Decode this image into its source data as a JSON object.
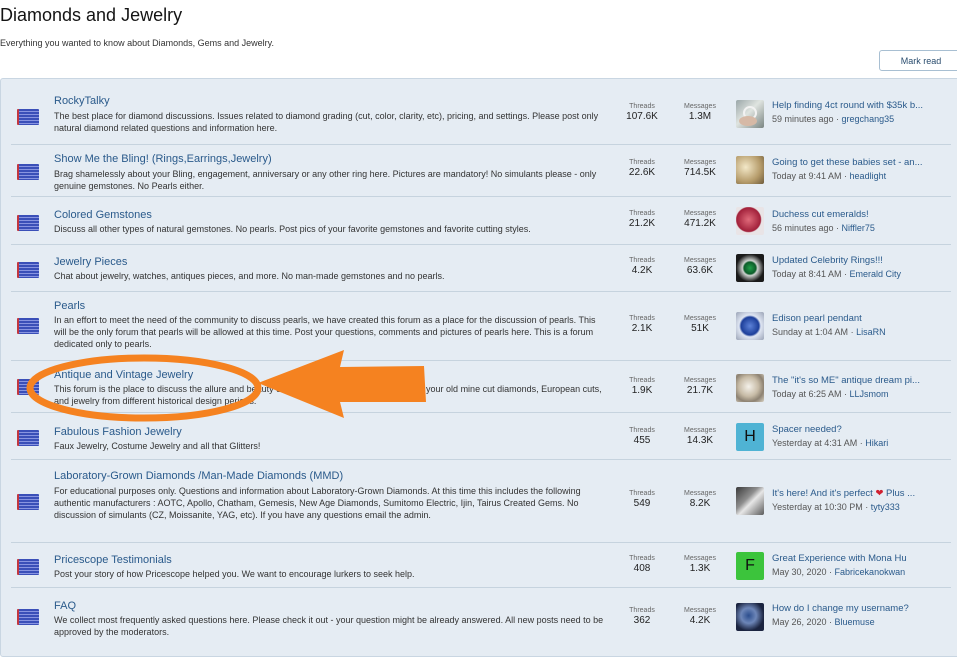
{
  "page": {
    "title": "Diamonds and Jewelry",
    "description": "Everything you wanted to know about Diamonds, Gems and Jewelry.",
    "mark_read_label": "Mark read"
  },
  "labels": {
    "threads": "Threads",
    "messages": "Messages"
  },
  "forums": [
    {
      "title": "RockyTalky",
      "description": "The best place for diamond discussions. Issues related to diamond grading (cut, color, clarity, etc), pricing, and settings. Please post only natural diamond related questions and information here.",
      "threads": "107.6K",
      "messages": "1.3M",
      "latest_title": "Help finding 4ct round with $35k b...",
      "latest_time": "59 minutes ago",
      "latest_user": "gregchang35",
      "avatar": "ring-hand-photo"
    },
    {
      "title": "Show Me the Bling! (Rings,Earrings,Jewelry)",
      "description": "Brag shamelessly about your Bling, engagement, anniversary or any other ring here. Pictures are mandatory! No simulants please - only genuine gemstones. No Pearls either.",
      "threads": "22.6K",
      "messages": "714.5K",
      "latest_title": "Going to get these babies set - an...",
      "latest_time": "Today at 9:41 AM",
      "latest_user": "headlight",
      "avatar": "earrings-photo"
    },
    {
      "title": "Colored Gemstones",
      "description": "Discuss all other types of natural gemstones. No pearls. Post pics of your favorite gemstones and favorite cutting styles.",
      "threads": "21.2K",
      "messages": "471.2K",
      "latest_title": "Duchess cut emeralds!",
      "latest_time": "56 minutes ago",
      "latest_user": "Niffler75",
      "avatar": "ruby-photo"
    },
    {
      "title": "Jewelry Pieces",
      "description": "Chat about jewelry, watches, antiques pieces, and more. No man-made gemstones and no pearls.",
      "threads": "4.2K",
      "messages": "63.6K",
      "latest_title": "Updated Celebrity Rings!!!",
      "latest_time": "Today at 8:41 AM",
      "latest_user": "Emerald City",
      "avatar": "emerald-ring-photo"
    },
    {
      "title": "Pearls",
      "description": "In an effort to meet the need of the community to discuss pearls, we have created this forum as a place for the discussion of pearls.  This will be the only forum that pearls will be allowed at this time.  Post your questions, comments and pictures of pearls here.  This is a forum dedicated only to pearls.",
      "threads": "2.1K",
      "messages": "51K",
      "latest_title": "Edison pearl pendant",
      "latest_time": "Sunday at 1:04 AM",
      "latest_user": "LisaRN",
      "avatar": "sapphire-photo"
    },
    {
      "title": "Antique and Vintage Jewelry",
      "description": "This forum is the place to discuss the allure and beauty of antique and vintage jewelry. Share your old mine cut diamonds, European cuts, and jewelry from different historical design periods.",
      "threads": "1.9K",
      "messages": "21.7K",
      "latest_title": "The \"it's so ME\" antique dream pi...",
      "latest_time": "Today at 6:25 AM",
      "latest_user": "LLJsmom",
      "avatar": "vintage-ring-photo"
    },
    {
      "title": "Fabulous Fashion Jewelry",
      "description": "Faux Jewelry, Costume Jewelry and all that Glitters!",
      "threads": "455",
      "messages": "14.3K",
      "latest_title": "Spacer needed?",
      "latest_time": "Yesterday at 4:31 AM",
      "latest_user": "Hikari",
      "avatar_letter": "H",
      "avatar_color": "#4fb3d4"
    },
    {
      "title": "Laboratory-Grown Diamonds /Man-Made Diamonds (MMD)",
      "description": "For educational purposes only. Questions and information about Laboratory-Grown Diamonds. At this time this includes the following authentic manufacturers : AOTC, Apollo, Chatham, Gemesis, New Age Diamonds, Sumitomo Electric, Ijin, Tairus Created Gems. No discussion of simulants (CZ, Moissanite, YAG, etc). If you have any questions email the admin.",
      "threads": "549",
      "messages": "8.2K",
      "latest_title": "It's here! And it's perfect",
      "latest_title_suffix": "Plus ...",
      "latest_time": "Yesterday at 10:30 PM",
      "latest_user": "tyty333",
      "avatar": "bracelet-photo"
    },
    {
      "title": "Pricescope Testimonials",
      "description": "Post your story of how Pricescope helped you. We want to encourage lurkers to seek help.",
      "threads": "408",
      "messages": "1.3K",
      "latest_title": "Great Experience with Mona Hu",
      "latest_time": "May 30, 2020",
      "latest_user": "Fabricekanokwan",
      "avatar_letter": "F",
      "avatar_color": "#3cc43c"
    },
    {
      "title": "FAQ",
      "description": "We collect most frequently asked questions here. Please check it out - your question might be already answered. All new posts need to be approved by the moderators.",
      "threads": "362",
      "messages": "4.2K",
      "latest_title": "How do I change my username?",
      "latest_time": "May 26, 2020",
      "latest_user": "Bluemuse",
      "avatar": "blue-ring-photo"
    }
  ],
  "colors": {
    "annotation": "#f58220",
    "link": "#2a5a8b",
    "row_bg": "#e5ecf3"
  }
}
